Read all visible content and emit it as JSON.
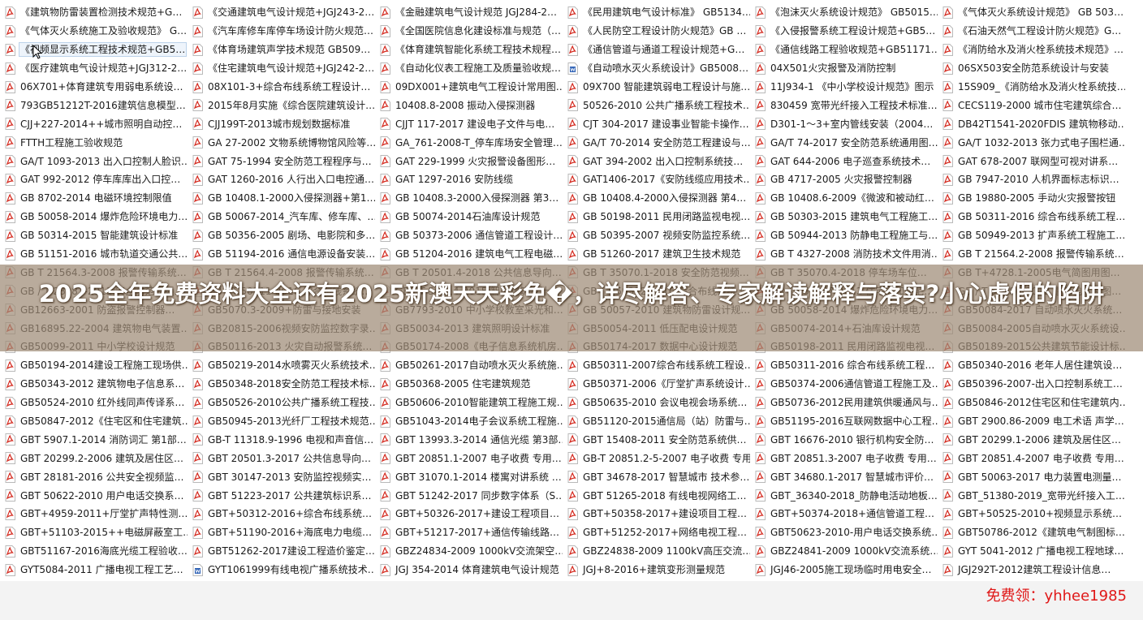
{
  "files": {
    "columns": [
      {
        "items": [
          "《建筑物防雷装置检测技术规范+G…",
          "《气体灭火系统施工及验收规范》 G…",
          "《视频显示系统工程技术规范+GB5…",
          "《医疗建筑电气设计规范+JGJ312-2…",
          "06X701+体育建筑专用弱电系统设…",
          "793GB51212T-2016建筑信息模型…",
          "CJJ+227-2014++城市照明自动控…",
          "FTTH工程施工验收规范",
          "GA/T 1093-2013 出入口控制人脸识…",
          "GAT 992-2012 停车库库出入口控…",
          "GB 8702-2014 电磁环境控制限值",
          "GB 50058-2014 爆炸危险环境电力…",
          "GB 50314-2015 智能建筑设计标准",
          "GB 51151-2016 城市轨道交通公共…",
          "GB T 21564.3-2008 报警传输系统…",
          "GB / T 28181-2011 安全防范视频…",
          "GB12663-2001 防盗报警控制器…",
          "GB16895.22-2004 建筑物电气装置…",
          "GB50099-2011 中小学校设计规范",
          "GB50194-2014建设工程施工现场供…",
          "GB50343-2012 建筑物电子信息系…",
          "GB50524-2010 红外线同声传译系…",
          "GB50847-2012《住宅区和住宅建筑…",
          "GBT 5907.1-2014 消防词汇 第1部…",
          "GBT 20299.2-2006 建筑及居住区…",
          "GBT 28181-2016 公共安全视频监…",
          "GBT 50622-2010 用户电话交换系…",
          "GBT+4959-2011+厅堂扩声特性测…",
          "GBT+51103-2015++电磁屏蔽室工…",
          "GBT51167-2016海底光缆工程验收…",
          "GYT5084-2011 广播电视工程工艺…"
        ]
      },
      {
        "items": [
          "《交通建筑电气设计规范+JGJ243-2…",
          "《汽车库修车库停车场设计防火规范…",
          "《体育场建筑声学技术规范 GB509…",
          "《住宅建筑电气设计规范+JGJ242-2…",
          "08X101-3+综合布线系统工程设计…",
          "2015年8月实施《综合医院建筑设计…",
          "CJJ199T-2013城市规划数据标准",
          "GA 27-2002 文物系统博物馆风险等…",
          "GAT 75-1994 安全防范工程程序与…",
          "GAT 1260-2016 人行出入口电控通…",
          "GB 10408.1-2000入侵探测器+第1…",
          "GB 50067-2014_汽车库、修车库、…",
          "GB 50356-2005 剧场、电影院和多…",
          "GB 51194-2016 通信电源设备安装…",
          "GB T 21564.4-2008 报警传输系统…",
          "GB / T 50311-2016 综合布线系统…",
          "GB5070.3-2009+防雷与接地安装",
          "GB20815-2006视频安防监控数字录…",
          "GB50116-2013 火灾自动报警系统…",
          "GB50219-2014水喷雾灭火系统技术…",
          "GB50348-2018安全防范工程技术标…",
          "GB50526-2010公共广播系统工程技…",
          "GB50945-2013光纤厂工程技术规范…",
          "GB-T 11318.9-1996 电视和声音信…",
          "GBT 20501.3-2017 公共信息导向…",
          "GBT 30147-2013 安防监控视频实…",
          "GBT 51223-2017 公共建筑标识系…",
          "GBT+50312-2016+综合布线系统…",
          "GBT+51190-2016+海底电力电缆…",
          "GBT51262-2017建设工程造价鉴定…",
          "GYT1061999有线电视广播系统技术…"
        ]
      },
      {
        "items": [
          "《金融建筑电气设计规范 JGJ284-2…",
          "《全国医院信息化建设标准与规范（…",
          "《体育建筑智能化系统工程技术规程…",
          "《自动化仪表工程施工及质量验收规…",
          "09DX001+建筑电气工程设计常用图…",
          "10408.8-2008 振动入侵探测器",
          "CJJT 117-2017 建设电子文件与电…",
          "GA_761-2008-T_停车库场安全管理…",
          "GAT 229-1999 火灾报警设备图形…",
          "GAT 1297-2016 安防线缆",
          "GB 10408.3-2000入侵探测器 第3…",
          "GB 50074-2014石油库设计规范",
          "GB 50373-2006 通信管道工程设计…",
          "GB 51204-2016 建筑电气工程电磁…",
          "GB T 20501.4-2018 公共信息导向…",
          "GB / T 50314-2015 智能建筑设计…",
          "GB7793-2010 中小学校教室采光和…",
          "GB50034-2013 建筑照明设计标准",
          "GB50174-2008《电子信息系统机房…",
          "GB50261-2017自动喷水灭火系统施…",
          "GB50368-2005 住宅建筑规范",
          "GB50606-2010智能建筑工程施工规…",
          "GB51043-2014电子会议系统工程施…",
          "GBT 13993.3-2014 通信光缆 第3部…",
          "GBT 20851.1-2007 电子收费 专用…",
          "GBT 31070.1-2014 楼寓对讲系统 …",
          "GBT 51242-2017 同步数字体系（S…",
          "GBT+50326-2017+建设工程项目…",
          "GBT+51217-2017+通信传输线路…",
          "GBZ24834-2009 1000kV交流架空…",
          "JGJ 354-2014 体育建筑电气设计规范"
        ]
      },
      {
        "items": [
          "《民用建筑电气设计标准》 GB5134…",
          "《人民防空工程设计防火规范》GB …",
          "《通信管道与通道工程设计规范+G…",
          "《自动喷水灭火系统设计》GB5008…",
          "09X700 智能建筑弱电工程设计与施…",
          "50526-2010 公共广播系统工程技术…",
          "CJT 304-2017 建设事业智能卡操作…",
          "GA/T 70-2014 安全防范工程建设与…",
          "GAT 394-2002 出入口控制系统技…",
          "GAT1406-2017《安防线缆应用技术…",
          "GB 10408.4-2000入侵探测器 第4…",
          "GB 50198-2011 民用闭路监视电视…",
          "GB 50395-2007 视频安防监控系统…",
          "GB 51260-2017 建筑卫生技术规范",
          "GB T 35070.1-2018 安全防范视频…",
          "GB / T 50312-2016 综合布线系统…",
          "GB 50057-2010 建筑物防雷设计规…",
          "GB50054-2011 低压配电设计规范",
          "GB50174-2017 数据中心设计规范",
          "GB50311-2007综合布线系统工程设…",
          "GB50371-2006《厅堂扩声系统设计…",
          "GB50635-2010 会议电视会场系统…",
          "GB51120-2015通信局（站）防雷与…",
          "GBT 15408-2011 安全防范系统供…",
          "GB-T 20851.2-5-2007 电子收费 专用…",
          "GBT 34678-2017 智慧城市 技术参…",
          "GBT 51265-2018 有线电视网络工…",
          "GBT+50358-2017+建设项目工程…",
          "GBT+51252-2017+网络电视工程…",
          "GBZ24838-2009 1100kV高压交流…",
          "JGJ+8-2016+建筑变形测量规范"
        ]
      },
      {
        "items": [
          "《泡沫灭火系统设计规范》 GB5015…",
          "《入侵报警系统工程设计规范+GB5…",
          "《通信线路工程验收规范+GB51171…",
          "04X501火灾报警及消防控制",
          "11J934-1 《中小学校设计规范》图示",
          "830459 宽带光纤接入工程技术标准…",
          "D301-1～3+室内管线安装（2004…",
          "GA/T 74-2017 安全防范系统通用图…",
          "GAT 644-2006 电子巡查系统技术…",
          "GB 4717-2005 火灾报警控制器",
          "GB 10408.6-2009《微波和被动红…",
          "GB 50303-2015 建筑电气工程施工…",
          "GB 50944-2013 防静电工程施工与…",
          "GB T 4327-2008 消防技术文件用消…",
          "GB T 35070.4-2018 停车场车位…",
          "GB / T 50847-2012 住宅区和住宅…",
          "GB 50058-2014 爆炸危险环境电力…",
          "GB50074-2014+石油库设计规范",
          "GB50198-2011 民用闭路监视电视…",
          "GB50311-2016 综合布线系统工程…",
          "GB50374-2006通信管道工程施工及…",
          "GB50736-2012民用建筑供暖通风与…",
          "GB51195-2016互联网数据中心工程…",
          "GBT 16676-2010 银行机构安全防…",
          "GBT 20851.3-2007 电子收费 专用…",
          "GBT 34680.1-2017 智慧城市评价…",
          "GBT_36340-2018_防静电活动地板…",
          "GBT+50374-2018+通信管道工程…",
          "GBT50623-2010-用户电话交换系统…",
          "GBZ24841-2009 1000kV交流系统…",
          "JGJ46-2005施工现场临时用电安全…"
        ]
      },
      {
        "items": [
          "《气体灭火系统设计规范》 GB 503…",
          "《石油天然气工程设计防火规范》G…",
          "《消防给水及消火栓系统技术规范》…",
          "06SX503安全防范系统设计与安装",
          "15S909_《消防给水及消火栓系统技…",
          "CECS119-2000 城市住宅建筑综合…",
          "DB42T1541-2020FDIS 建筑物移动…",
          "GA/T 1032-2013 张力式电子围栏通…",
          "GAT 678-2007 联网型可视对讲系…",
          "GB 7947-2010 人机界面标志标识…",
          "GB 19880-2005 手动火灾报警按钮",
          "GB 50311-2016 综合布线系统工程…",
          "GB 50949-2013 扩声系统工程施工…",
          "GB T 21564.2-2008 报警传输系统…",
          "GB T+4728.1-2005电气简图用图…",
          "GB / T 50786-2012 建筑电气制图…",
          "GB50084-2017 自动喷水灭火系统…",
          "GB50084-2005自动喷水灭火系统设…",
          "GB50189-2015公共建筑节能设计标…",
          "GB50340-2016 老年人居住建筑设…",
          "GB50396-2007-出入口控制系统工…",
          "GB50846-2012住宅区和住宅建筑内…",
          "GBT 2900.86-2009 电工术语 声学…",
          "GBT 20299.1-2006 建筑及居住区…",
          "GBT 20851.4-2007 电子收费 专用…",
          "GBT 50063-2017 电力装置电测量…",
          "GBT_51380-2019_宽带光纤接入工…",
          "GBT+50525-2010+视频显示系统…",
          "GBT50786-2012《建筑电气制图标…",
          "GYT 5041-2012 广播电视工程地球…",
          "JGJ292T-2012建筑工程设计信息…"
        ]
      }
    ]
  },
  "headline": "2025全年免费资料大全还有2025新澳天天彩免�，详尽解答、专家解读解释与落实?小心虚假的陷阱",
  "watermark": "免费领：yhhee1985",
  "colors": {
    "overlay": "#9e8b76",
    "watermark": "#e01818",
    "pdf_icon": "#d42a1f",
    "doc_icon": "#2b5fb4"
  },
  "icons": {
    "pdf": "pdf-file-icon",
    "doc": "doc-file-icon"
  }
}
